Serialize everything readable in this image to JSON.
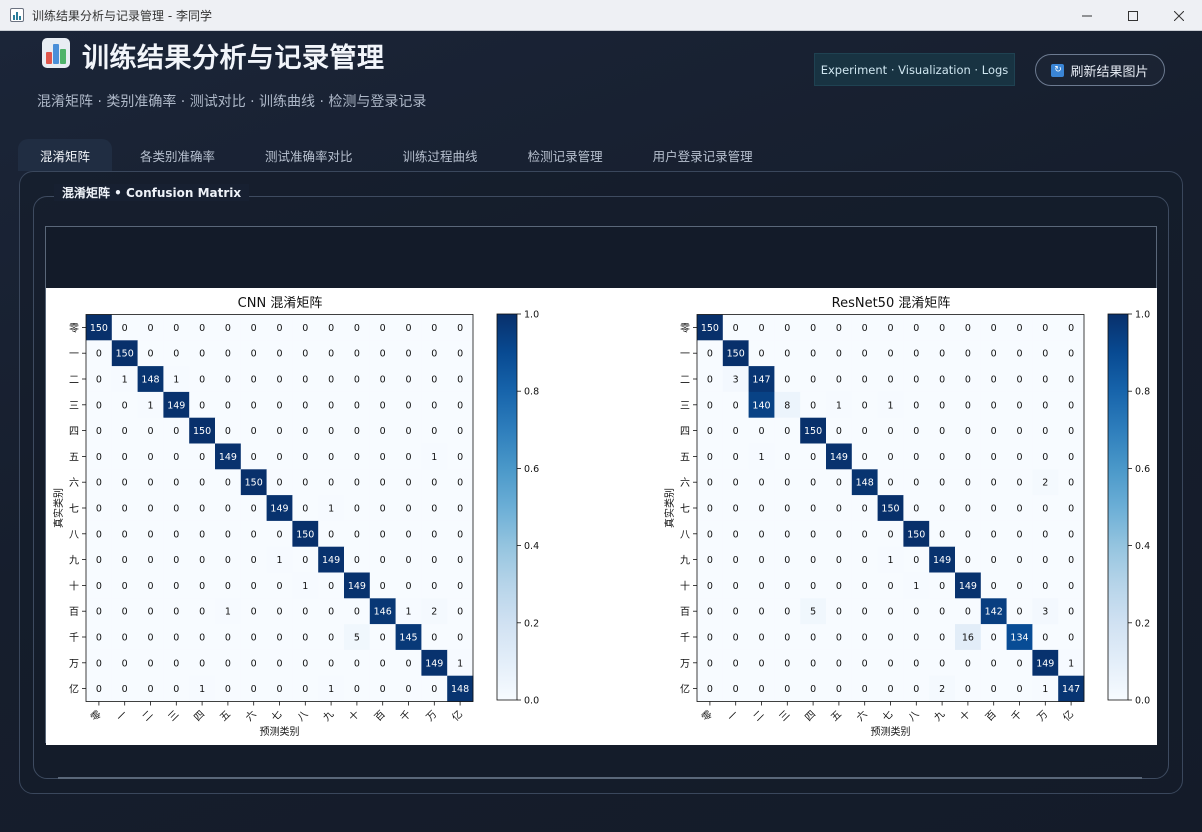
{
  "window": {
    "title": "训练结果分析与记录管理 - 李同学"
  },
  "header": {
    "title": "训练结果分析与记录管理",
    "subtitle": "混淆矩阵 · 类别准确率 · 测试对比 · 训练曲线 · 检测与登录记录",
    "pill": "Experiment · Visualization · Logs",
    "refresh_label": "刷新结果图片"
  },
  "tabs": [
    "混淆矩阵",
    "各类别准确率",
    "测试准确率对比",
    "训练过程曲线",
    "检测记录管理",
    "用户登录记录管理"
  ],
  "active_tab": 0,
  "group_title": "混淆矩阵 • Confusion Matrix",
  "colors": {
    "accent": "#3a85d6",
    "matrix_dark": "#08306b",
    "matrix_light": "#f7fbff"
  },
  "chart_data": [
    {
      "type": "heatmap",
      "title": "CNN 混淆矩阵",
      "xlabel": "预测类别",
      "ylabel": "真实类别",
      "categories": [
        "零",
        "一",
        "二",
        "三",
        "四",
        "五",
        "六",
        "七",
        "八",
        "九",
        "十",
        "百",
        "千",
        "万",
        "亿"
      ],
      "colorbar": {
        "range": [
          0.0,
          1.0
        ],
        "ticks": [
          "0.0",
          "0.2",
          "0.4",
          "0.6",
          "0.8",
          "1.0"
        ]
      },
      "values": [
        [
          150,
          0,
          0,
          0,
          0,
          0,
          0,
          0,
          0,
          0,
          0,
          0,
          0,
          0,
          0
        ],
        [
          0,
          150,
          0,
          0,
          0,
          0,
          0,
          0,
          0,
          0,
          0,
          0,
          0,
          0,
          0
        ],
        [
          0,
          1,
          148,
          1,
          0,
          0,
          0,
          0,
          0,
          0,
          0,
          0,
          0,
          0,
          0
        ],
        [
          0,
          0,
          1,
          149,
          0,
          0,
          0,
          0,
          0,
          0,
          0,
          0,
          0,
          0,
          0
        ],
        [
          0,
          0,
          0,
          0,
          150,
          0,
          0,
          0,
          0,
          0,
          0,
          0,
          0,
          0,
          0
        ],
        [
          0,
          0,
          0,
          0,
          0,
          149,
          0,
          0,
          0,
          0,
          0,
          0,
          0,
          1,
          0
        ],
        [
          0,
          0,
          0,
          0,
          0,
          0,
          150,
          0,
          0,
          0,
          0,
          0,
          0,
          0,
          0
        ],
        [
          0,
          0,
          0,
          0,
          0,
          0,
          0,
          149,
          0,
          1,
          0,
          0,
          0,
          0,
          0
        ],
        [
          0,
          0,
          0,
          0,
          0,
          0,
          0,
          0,
          150,
          0,
          0,
          0,
          0,
          0,
          0
        ],
        [
          0,
          0,
          0,
          0,
          0,
          0,
          0,
          1,
          0,
          149,
          0,
          0,
          0,
          0,
          0
        ],
        [
          0,
          0,
          0,
          0,
          0,
          0,
          0,
          0,
          1,
          0,
          149,
          0,
          0,
          0,
          0
        ],
        [
          0,
          0,
          0,
          0,
          0,
          1,
          0,
          0,
          0,
          0,
          0,
          146,
          1,
          2,
          0
        ],
        [
          0,
          0,
          0,
          0,
          0,
          0,
          0,
          0,
          0,
          0,
          5,
          0,
          145,
          0,
          0
        ],
        [
          0,
          0,
          0,
          0,
          0,
          0,
          0,
          0,
          0,
          0,
          0,
          0,
          0,
          149,
          1
        ],
        [
          0,
          0,
          0,
          0,
          1,
          0,
          0,
          0,
          0,
          1,
          0,
          0,
          0,
          0,
          148
        ]
      ]
    },
    {
      "type": "heatmap",
      "title": "ResNet50 混淆矩阵",
      "xlabel": "预测类别",
      "ylabel": "真实类别",
      "categories": [
        "零",
        "一",
        "二",
        "三",
        "四",
        "五",
        "六",
        "七",
        "八",
        "九",
        "十",
        "百",
        "千",
        "万",
        "亿"
      ],
      "colorbar": {
        "range": [
          0.0,
          1.0
        ],
        "ticks": [
          "0.0",
          "0.2",
          "0.4",
          "0.6",
          "0.8",
          "1.0"
        ]
      },
      "values": [
        [
          150,
          0,
          0,
          0,
          0,
          0,
          0,
          0,
          0,
          0,
          0,
          0,
          0,
          0,
          0
        ],
        [
          0,
          150,
          0,
          0,
          0,
          0,
          0,
          0,
          0,
          0,
          0,
          0,
          0,
          0,
          0
        ],
        [
          0,
          3,
          147,
          0,
          0,
          0,
          0,
          0,
          0,
          0,
          0,
          0,
          0,
          0,
          0
        ],
        [
          0,
          0,
          140,
          8,
          0,
          1,
          0,
          1,
          0,
          0,
          0,
          0,
          0,
          0,
          0
        ],
        [
          0,
          0,
          0,
          0,
          150,
          0,
          0,
          0,
          0,
          0,
          0,
          0,
          0,
          0,
          0
        ],
        [
          0,
          0,
          1,
          0,
          0,
          149,
          0,
          0,
          0,
          0,
          0,
          0,
          0,
          0,
          0
        ],
        [
          0,
          0,
          0,
          0,
          0,
          0,
          148,
          0,
          0,
          0,
          0,
          0,
          0,
          2,
          0
        ],
        [
          0,
          0,
          0,
          0,
          0,
          0,
          0,
          150,
          0,
          0,
          0,
          0,
          0,
          0,
          0
        ],
        [
          0,
          0,
          0,
          0,
          0,
          0,
          0,
          0,
          150,
          0,
          0,
          0,
          0,
          0,
          0
        ],
        [
          0,
          0,
          0,
          0,
          0,
          0,
          0,
          1,
          0,
          149,
          0,
          0,
          0,
          0,
          0
        ],
        [
          0,
          0,
          0,
          0,
          0,
          0,
          0,
          0,
          1,
          0,
          149,
          0,
          0,
          0,
          0
        ],
        [
          0,
          0,
          0,
          0,
          5,
          0,
          0,
          0,
          0,
          0,
          0,
          142,
          0,
          3,
          0
        ],
        [
          0,
          0,
          0,
          0,
          0,
          0,
          0,
          0,
          0,
          0,
          16,
          0,
          134,
          0,
          0
        ],
        [
          0,
          0,
          0,
          0,
          0,
          0,
          0,
          0,
          0,
          0,
          0,
          0,
          0,
          149,
          1
        ],
        [
          0,
          0,
          0,
          0,
          0,
          0,
          0,
          0,
          0,
          2,
          0,
          0,
          0,
          1,
          147
        ]
      ]
    }
  ]
}
